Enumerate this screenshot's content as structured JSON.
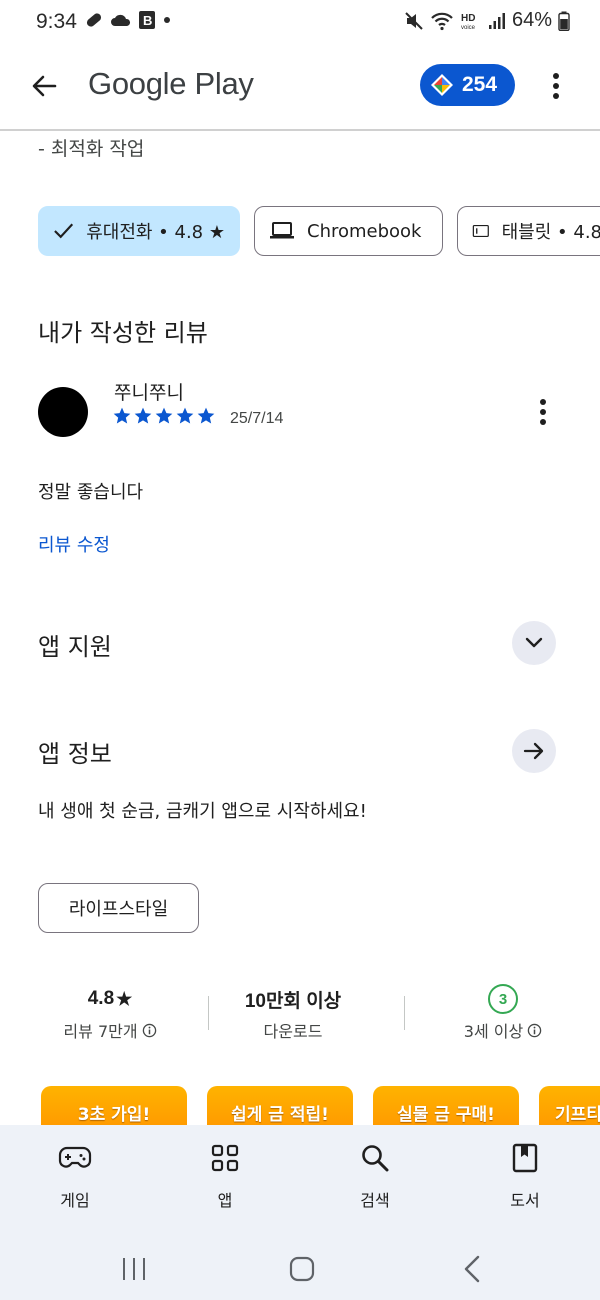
{
  "status_bar": {
    "time": "9:34",
    "battery": "64%"
  },
  "app_bar": {
    "title": "Google Play",
    "points": "254"
  },
  "description_tail": "- 최적화 작업",
  "device_chips": [
    {
      "label": "휴대전화 • 4.8 ★",
      "selected": true
    },
    {
      "label": "Chromebook",
      "selected": false
    },
    {
      "label": "태블릿 • 4.8",
      "selected": false
    }
  ],
  "my_review": {
    "heading": "내가 작성한 리뷰",
    "reviewer": "쭈니쭈니",
    "rating": 5,
    "date": "25/7/14",
    "text": "정말 좋습니다",
    "edit_label": "리뷰 수정"
  },
  "app_support": {
    "heading": "앱 지원"
  },
  "app_info": {
    "heading": "앱 정보",
    "description": "내 생애 첫 순금, 금캐기 앱으로 시작하세요!",
    "category": "라이프스타일"
  },
  "stats": {
    "rating_value": "4.8",
    "rating_star": "★",
    "reviews_label": "리뷰 7만개",
    "downloads_value": "10만회 이상",
    "downloads_label": "다운로드",
    "age_badge": "3",
    "age_label": "3세 이상"
  },
  "screenshots": [
    "3초 가입!",
    "쉽게 금 적립!",
    "실물 금 구매!",
    "기프티"
  ],
  "bottom_nav": [
    {
      "label": "게임",
      "icon": "gamepad-icon"
    },
    {
      "label": "앱",
      "icon": "apps-grid-icon"
    },
    {
      "label": "검색",
      "icon": "search-icon"
    },
    {
      "label": "도서",
      "icon": "book-icon"
    }
  ],
  "colors": {
    "accent": "#0b57d0",
    "selected_chip": "#c2e7ff",
    "age_badge": "#34a853",
    "nav_background": "#eef2f8",
    "screenshot_orange": "#ffa000"
  }
}
